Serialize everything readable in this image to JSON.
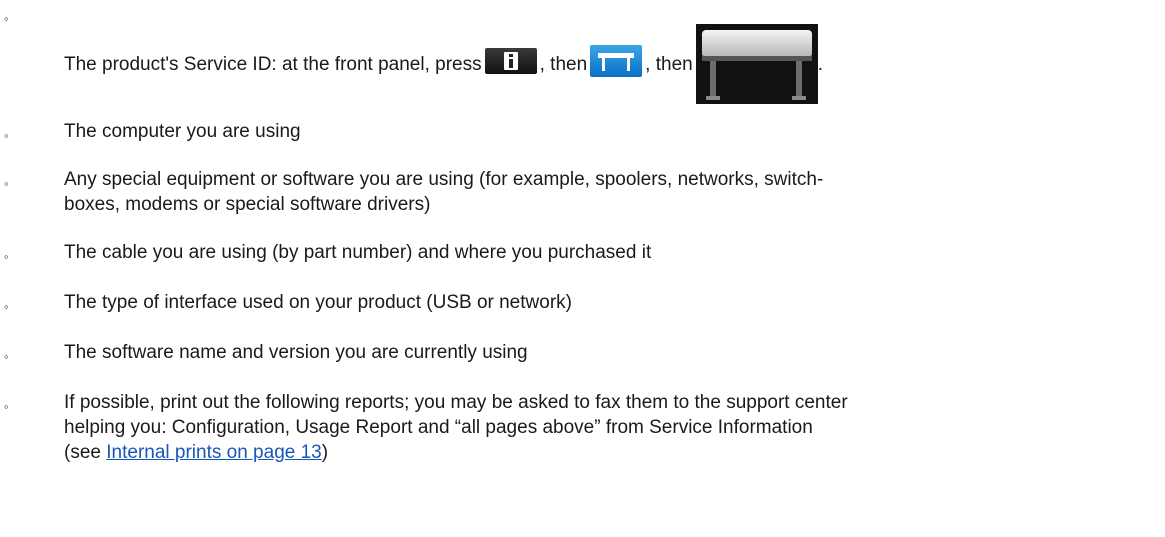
{
  "items": [
    {
      "bullet": "◦",
      "text_before": "The product's Service ID: at the front panel, press",
      "sep1": ", then",
      "sep2": ", then",
      "end": ".",
      "icons": [
        "info-button-icon",
        "printer-button-icon",
        "printer-photo-icon"
      ]
    },
    {
      "bullet": "◦",
      "text": "The computer you are using"
    },
    {
      "bullet": "◦",
      "line1": "Any special equipment or software you are using (for example, spoolers, networks, switch-",
      "line2": "boxes, modems or special software drivers)"
    },
    {
      "bullet": "◦",
      "text": "The cable you are using (by part number) and where you purchased it"
    },
    {
      "bullet": "◦",
      "text": "The type of interface used on your product (USB or network)"
    },
    {
      "bullet": "◦",
      "text": "The software name and version you are currently using"
    },
    {
      "bullet": "◦",
      "line1": "If possible, print out the following reports; you may be asked to fax them to the support center",
      "line2": "helping you: Configuration, Usage Report and “all pages above” from Service Information",
      "line3_before": "(see ",
      "link": "Internal prints on page 13",
      "line3_after": ")"
    }
  ],
  "colors": {
    "text": "#1a1a1a",
    "link": "#1a56b8",
    "printer_button": "#1e8ad6"
  }
}
